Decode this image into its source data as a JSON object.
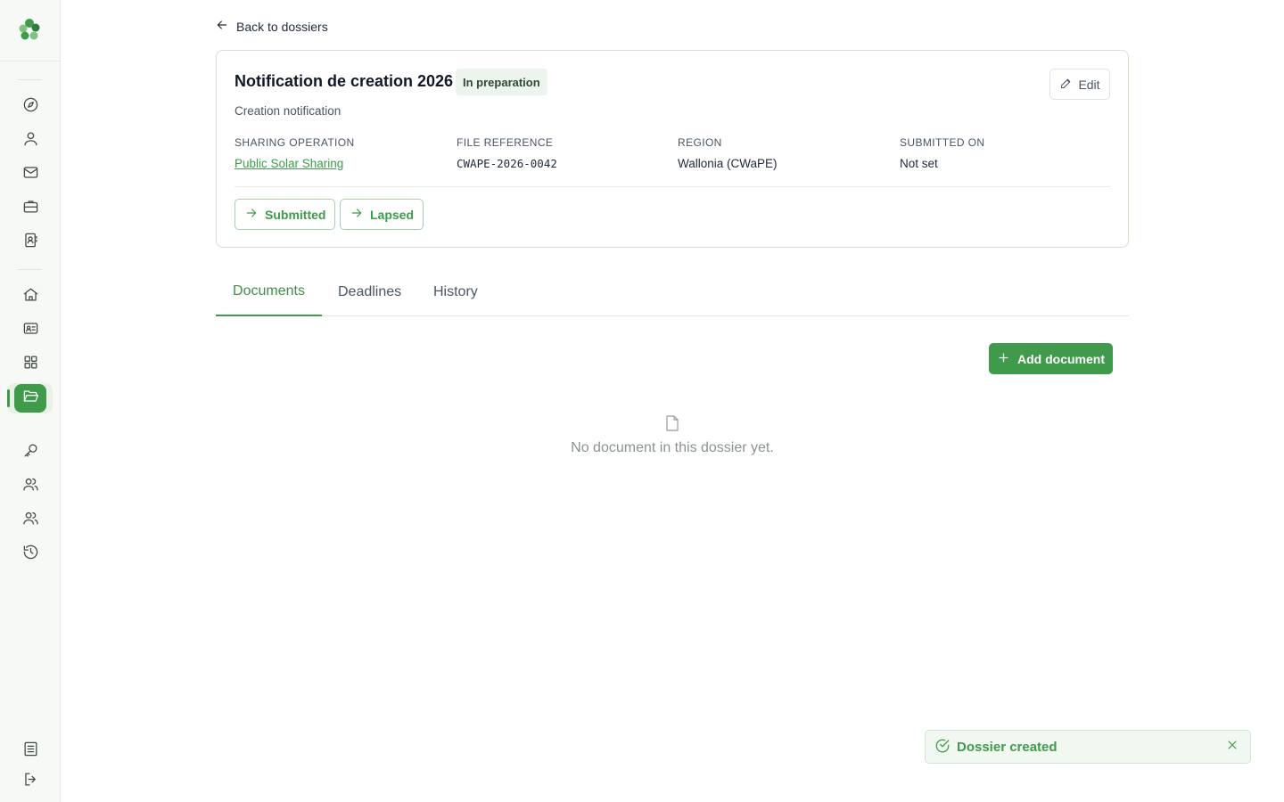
{
  "app": {
    "brand_color": "#3f9a4b",
    "logo_icon": "clover-logo-icon"
  },
  "sidebar": {
    "items": [
      {
        "name": "compass-icon",
        "active": false
      },
      {
        "name": "user-icon",
        "active": false
      },
      {
        "name": "mail-icon",
        "active": false
      },
      {
        "name": "briefcase-icon",
        "active": false
      },
      {
        "name": "contact-book-icon",
        "active": false
      },
      {
        "name": "home-icon",
        "active": false
      },
      {
        "name": "id-card-icon",
        "active": false
      },
      {
        "name": "grid-icon",
        "active": false
      },
      {
        "name": "folder-open-icon",
        "active": true
      },
      {
        "name": "key-icon",
        "active": false
      },
      {
        "name": "users-icon",
        "active": false
      },
      {
        "name": "team-icon",
        "active": false
      },
      {
        "name": "history-icon",
        "active": false
      }
    ],
    "bottom_items": [
      {
        "name": "document-list-icon"
      },
      {
        "name": "logout-icon"
      }
    ]
  },
  "back_link": {
    "label": "Back to dossiers"
  },
  "dossier": {
    "title": "Notification de creation 2026",
    "status": "In preparation",
    "subtitle": "Creation notification",
    "edit_label": "Edit",
    "fields": [
      {
        "label": "SHARING OPERATION",
        "value": "Public Solar Sharing"
      },
      {
        "label": "FILE REFERENCE",
        "value": "CWAPE-2026-0042"
      },
      {
        "label": "REGION",
        "value": "Wallonia (CWaPE)"
      },
      {
        "label": "SUBMITTED ON",
        "value": "Not set"
      }
    ],
    "transitions": [
      "Submitted",
      "Lapsed"
    ]
  },
  "tabs": [
    {
      "label": "Documents",
      "active": true
    },
    {
      "label": "Deadlines",
      "active": false
    },
    {
      "label": "History",
      "active": false
    }
  ],
  "documents": {
    "add_label": "Add document",
    "empty_text": "No document in this dossier yet."
  },
  "toast": {
    "message": "Dossier created"
  }
}
